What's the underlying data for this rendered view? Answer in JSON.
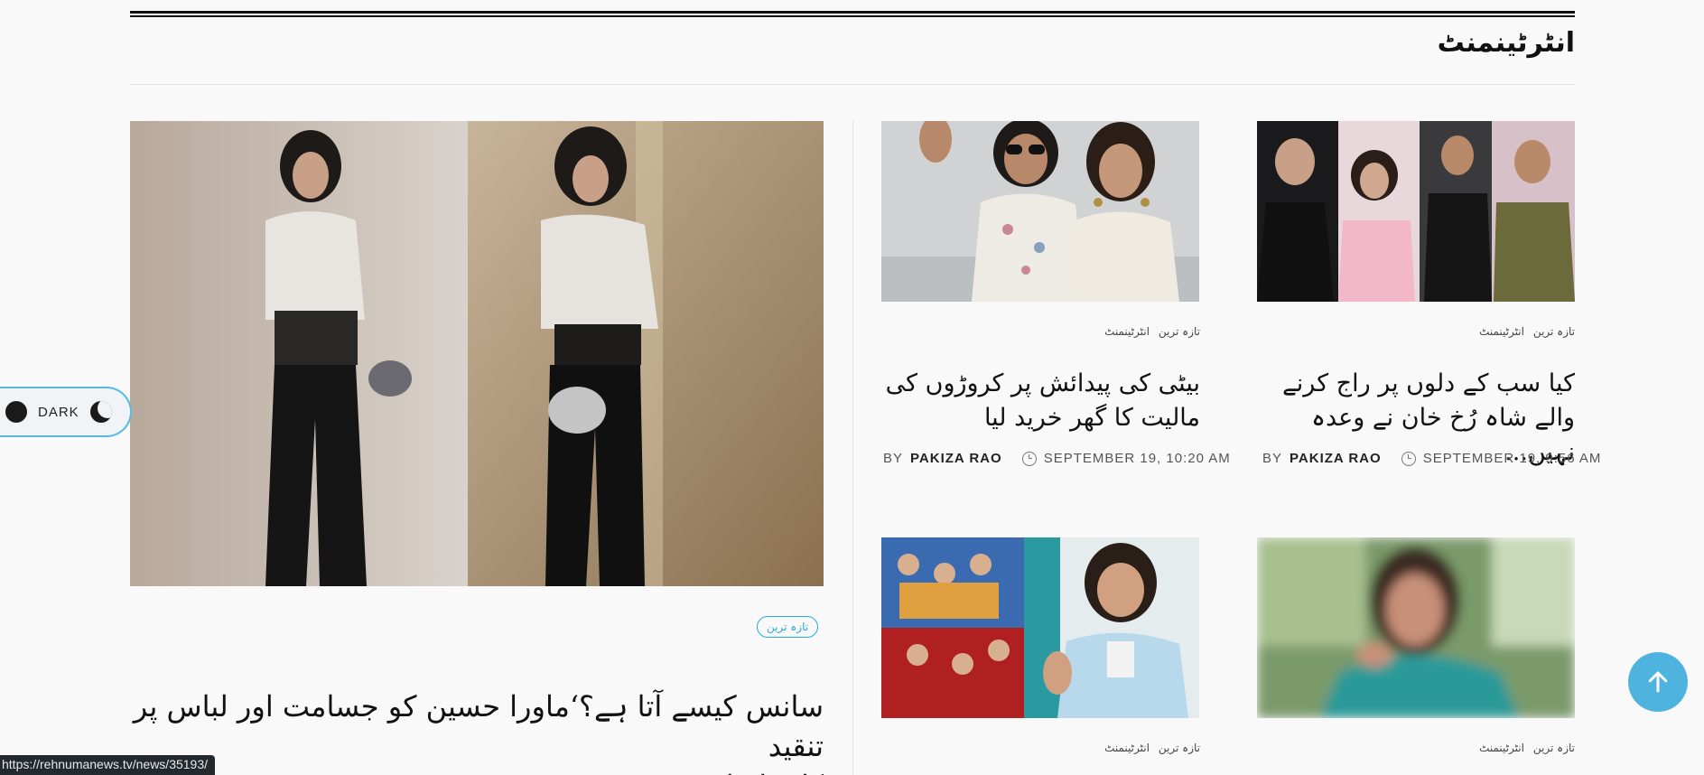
{
  "section": {
    "title": "انٹرٹینمنٹ"
  },
  "toggle": {
    "label": "DARK"
  },
  "featured": {
    "tag": "تازہ ترین",
    "title_line1": "سانس کیسے آتا ہے؟‘ماورا حسین کو جسامت اور لباس پر تنقید",
    "title_line2": "کا سامنا"
  },
  "cards": [
    {
      "cat1": "انٹرٹینمنٹ",
      "cat2": "تازہ ترین",
      "title_line1": "بیٹی کی پیدائش پر کروڑوں کی",
      "title_line2": "مالیت کا گھر خرید لیا",
      "by": "BY",
      "author": "PAKIZA RAO",
      "date": "SEPTEMBER 19, 10:20 AM"
    },
    {
      "cat1": "انٹرٹینمنٹ",
      "cat2": "تازہ ترین",
      "title_line1": "کیا سب کے دلوں پر راج کرنے",
      "title_line2": "والے شاہ رُخ خان نے وعدہ نہیں...",
      "by": "BY",
      "author": "PAKIZA RAO",
      "date": "SEPTEMBER 19, 9:56 AM"
    },
    {
      "cat1": "انٹرٹینمنٹ",
      "cat2": "تازہ ترین"
    },
    {
      "cat1": "انٹرٹینمنٹ",
      "cat2": "تازہ ترین"
    }
  ],
  "status_bar": {
    "url": "https://rehnumanews.tv/news/35193/"
  },
  "icons": {
    "toggle_dot": "dark-dot-icon",
    "moon": "moon-icon",
    "clock": "clock-icon",
    "scroll_top": "arrow-up-icon"
  },
  "colors": {
    "accent": "#4fb3e0",
    "text": "#111111",
    "background": "#f9f9f9"
  }
}
